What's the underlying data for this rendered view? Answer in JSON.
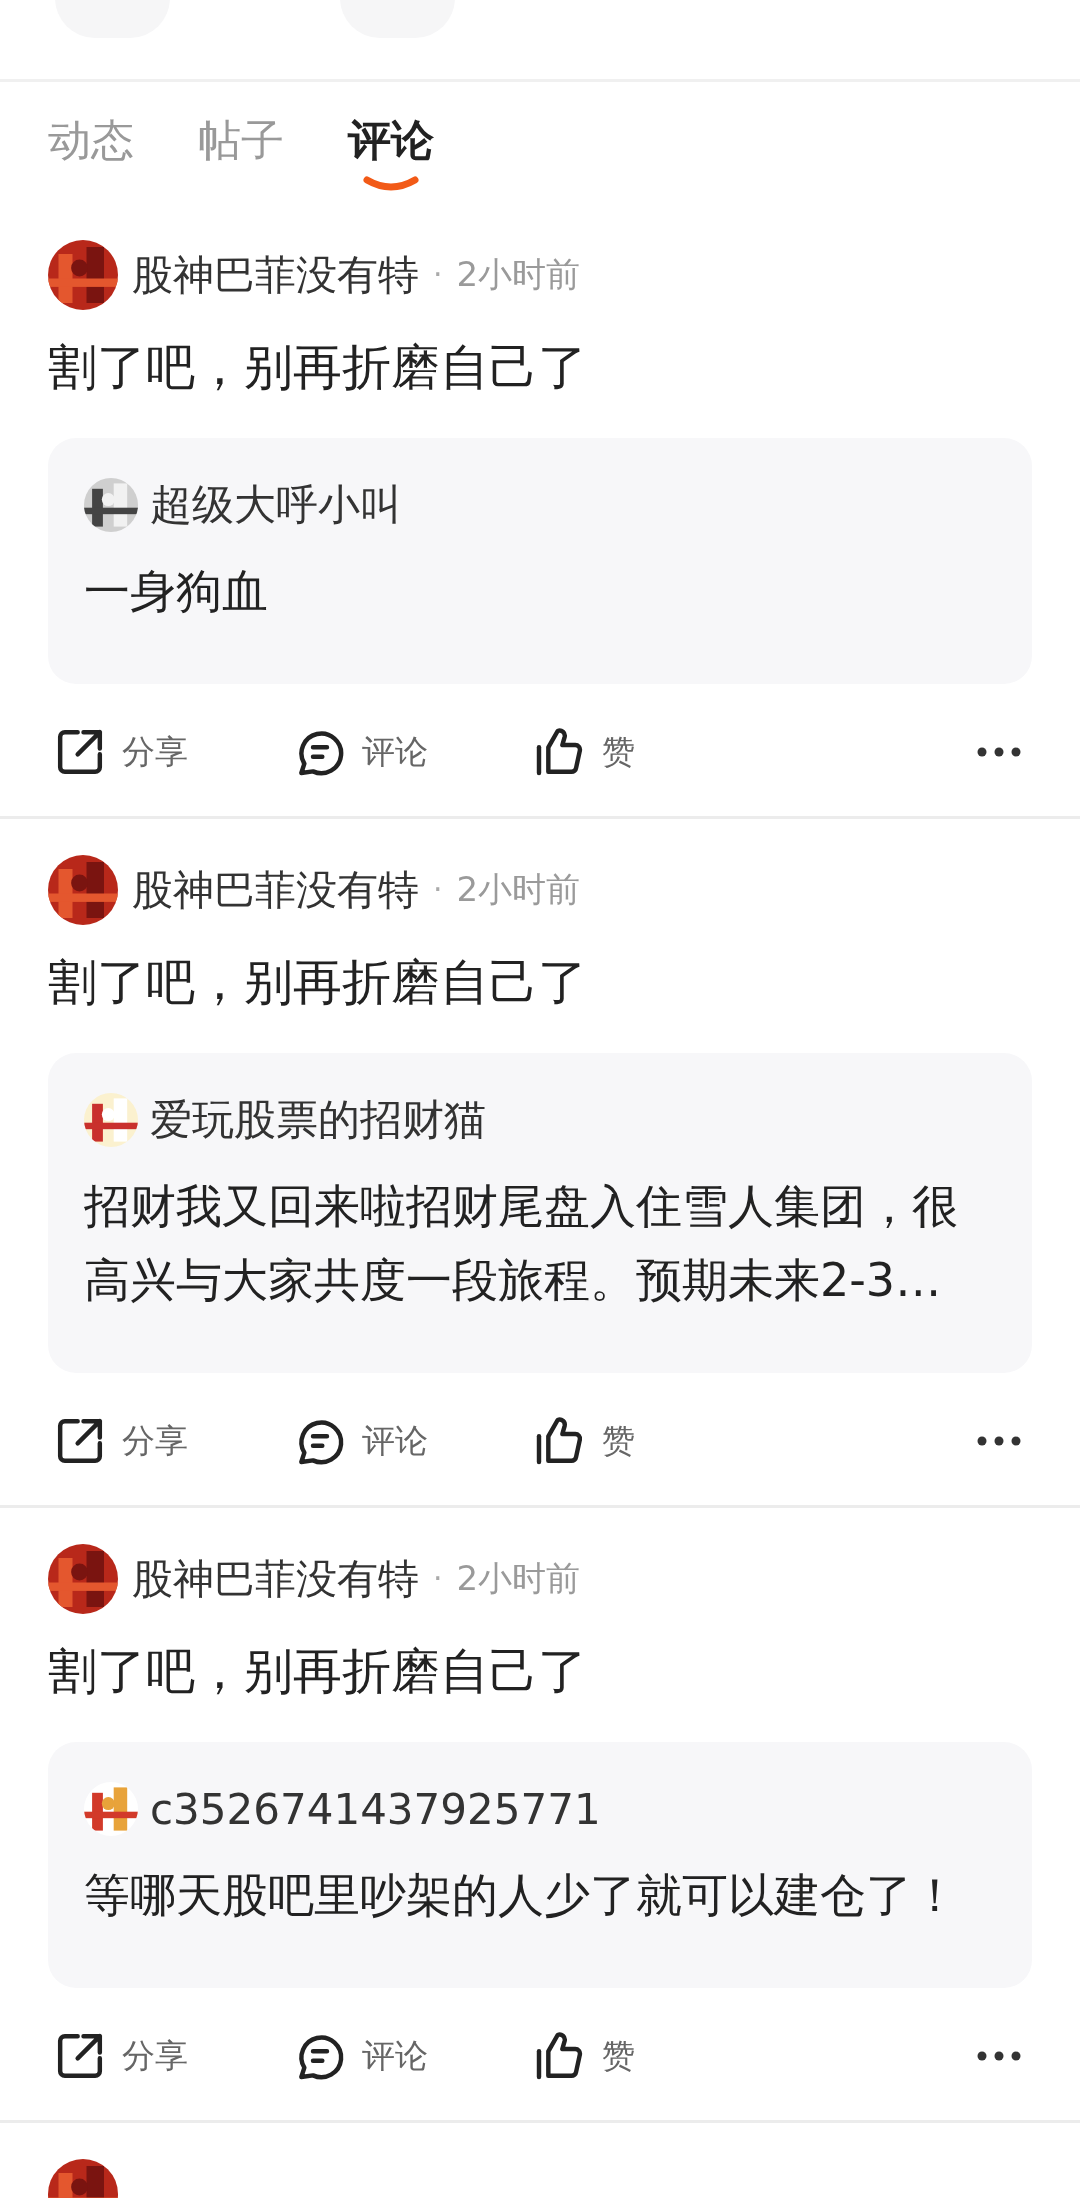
{
  "tabs": [
    {
      "label": "动态",
      "selected": false
    },
    {
      "label": "帖子",
      "selected": false
    },
    {
      "label": "评论",
      "selected": true
    }
  ],
  "posts": [
    {
      "author": "股神巴菲没有特",
      "separator": "·",
      "time": "2小时前",
      "content": "割了吧，别再折磨自己了",
      "quote": {
        "author": "超级大呼小叫",
        "text": "一身狗血"
      },
      "actions": [
        {
          "kind": "share",
          "label": "分享"
        },
        {
          "kind": "comment",
          "label": "评论"
        },
        {
          "kind": "like",
          "label": "赞"
        }
      ]
    },
    {
      "author": "股神巴菲没有特",
      "separator": "·",
      "time": "2小时前",
      "content": "割了吧，别再折磨自己了",
      "quote": {
        "author": "爱玩股票的招财猫",
        "text": "招财我又回来啦招财尾盘入住雪人集团，很高兴与大家共度一段旅程。预期未来2-3…"
      },
      "actions": [
        {
          "kind": "share",
          "label": "分享"
        },
        {
          "kind": "comment",
          "label": "评论"
        },
        {
          "kind": "like",
          "label": "赞"
        }
      ]
    },
    {
      "author": "股神巴菲没有特",
      "separator": "·",
      "time": "2小时前",
      "content": "割了吧，别再折磨自己了",
      "quote": {
        "author": "c3526741437925771",
        "text": "等哪天股吧里吵架的人少了就可以建仓了！"
      },
      "actions": [
        {
          "kind": "share",
          "label": "分享"
        },
        {
          "kind": "comment",
          "label": "评论"
        },
        {
          "kind": "like",
          "label": "赞"
        }
      ]
    }
  ]
}
